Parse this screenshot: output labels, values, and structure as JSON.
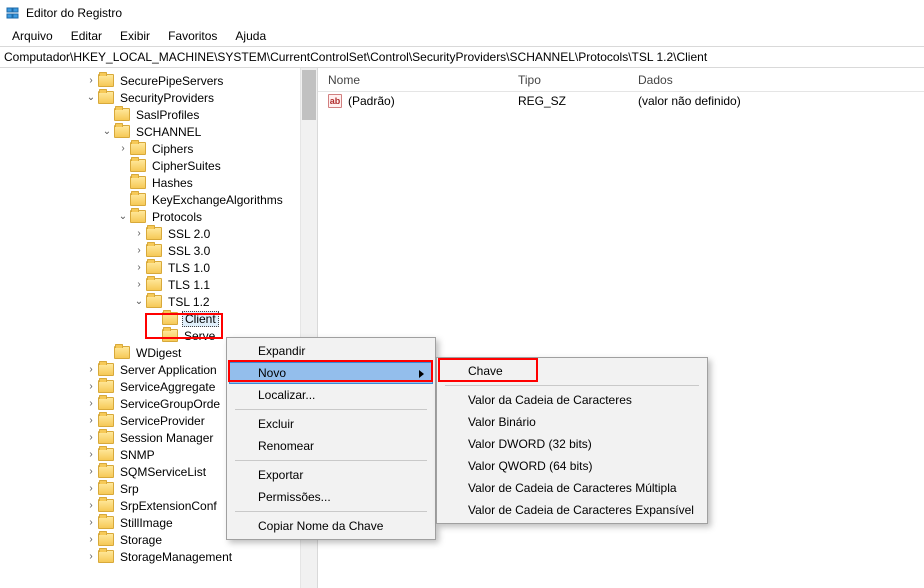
{
  "window": {
    "title": "Editor do Registro"
  },
  "menu": {
    "arquivo": "Arquivo",
    "editar": "Editar",
    "exibir": "Exibir",
    "favoritos": "Favoritos",
    "ajuda": "Ajuda"
  },
  "address": "Computador\\HKEY_LOCAL_MACHINE\\SYSTEM\\CurrentControlSet\\Control\\SecurityProviders\\SCHANNEL\\Protocols\\TSL 1.2\\Client",
  "tree": {
    "securepipe": "SecurePipeServers",
    "securityproviders": "SecurityProviders",
    "saslprofiles": "SaslProfiles",
    "schannel": "SCHANNEL",
    "ciphers": "Ciphers",
    "ciphersuites": "CipherSuites",
    "hashes": "Hashes",
    "keyexchange": "KeyExchangeAlgorithms",
    "protocols": "Protocols",
    "ssl20": "SSL 2.0",
    "ssl30": "SSL 3.0",
    "tls10": "TLS 1.0",
    "tls11": "TLS 1.1",
    "tsl12": "TSL 1.2",
    "client": "Client",
    "serve": "Serve",
    "wdigest": "WDigest",
    "serverapp": "Server Application",
    "serviceagg": "ServiceAggregate",
    "servicegroup": "ServiceGroupOrde",
    "serviceprovider": "ServiceProvider",
    "sessionmgr": "Session Manager",
    "snmp": "SNMP",
    "sqm": "SQMServiceList",
    "srp": "Srp",
    "srpext": "SrpExtensionConf",
    "stillimage": "StillImage",
    "storage": "Storage",
    "storagemgmt": "StorageManagement"
  },
  "list": {
    "cols": {
      "nome": "Nome",
      "tipo": "Tipo",
      "dados": "Dados"
    },
    "row1": {
      "name": "(Padrão)",
      "type": "REG_SZ",
      "data": "(valor não definido)",
      "iconlabel": "ab"
    }
  },
  "ctx1": {
    "expandir": "Expandir",
    "novo": "Novo",
    "localizar": "Localizar...",
    "excluir": "Excluir",
    "renomear": "Renomear",
    "exportar": "Exportar",
    "permissoes": "Permissões...",
    "copiar": "Copiar Nome da Chave"
  },
  "ctx2": {
    "chave": "Chave",
    "valorcadeia": "Valor da Cadeia de Caracteres",
    "valorbin": "Valor Binário",
    "valordword": "Valor DWORD (32 bits)",
    "valorqword": "Valor QWORD (64 bits)",
    "valormulti": "Valor de Cadeia de Caracteres Múltipla",
    "valorexp": "Valor de Cadeia de Caracteres Expansível"
  }
}
